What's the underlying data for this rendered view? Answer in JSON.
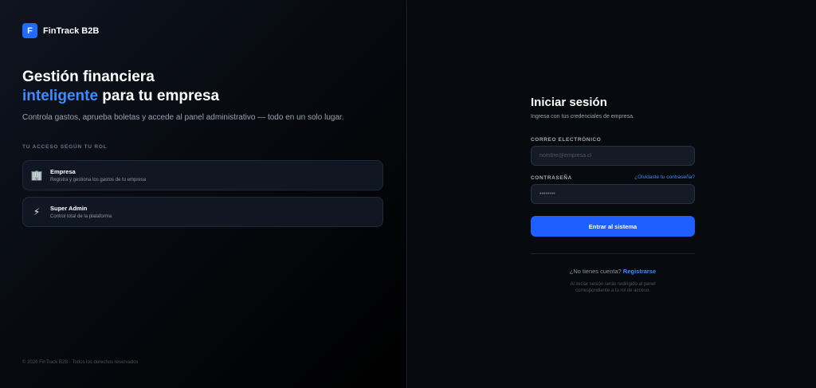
{
  "brand": {
    "logo_letter": "F",
    "name": "FinTrack B2B"
  },
  "hero": {
    "title_line1": "Gestión financiera",
    "title_accent": "inteligente",
    "title_rest": " para tu empresa",
    "subtitle": "Controla gastos, aprueba boletas y accede al panel administrativo — todo en un solo lugar."
  },
  "roles": {
    "label": "TU ACCESO SEGÚN TU ROL",
    "items": [
      {
        "icon": "building-icon",
        "glyph": "🏢",
        "title": "Empresa",
        "desc": "Registra y gestiona los gastos de tu empresa"
      },
      {
        "icon": "lightning-icon",
        "glyph": "⚡",
        "title": "Super Admin",
        "desc": "Control total de la plataforma"
      }
    ]
  },
  "footer": "© 2026 FinTrack B2B · Todos los derechos reservados",
  "login": {
    "title": "Iniciar sesión",
    "subtitle": "Ingresa con tus credenciales de empresa.",
    "email_label": "CORREO ELECTRÓNICO",
    "email_placeholder": "nombre@empresa.cl",
    "password_label": "CONTRASEÑA",
    "password_value": "••••••••",
    "forgot": "¿Olvidaste tu contraseña?",
    "submit": "Entrar al sistema",
    "register_prompt": "¿No tienes cuenta?",
    "register_link": "Registrarse",
    "note": "Al iniciar sesión serás redirigido al panel correspondiente a tu rol de acceso."
  },
  "colors": {
    "accent": "#3d8bff",
    "button": "#1f5fff"
  }
}
